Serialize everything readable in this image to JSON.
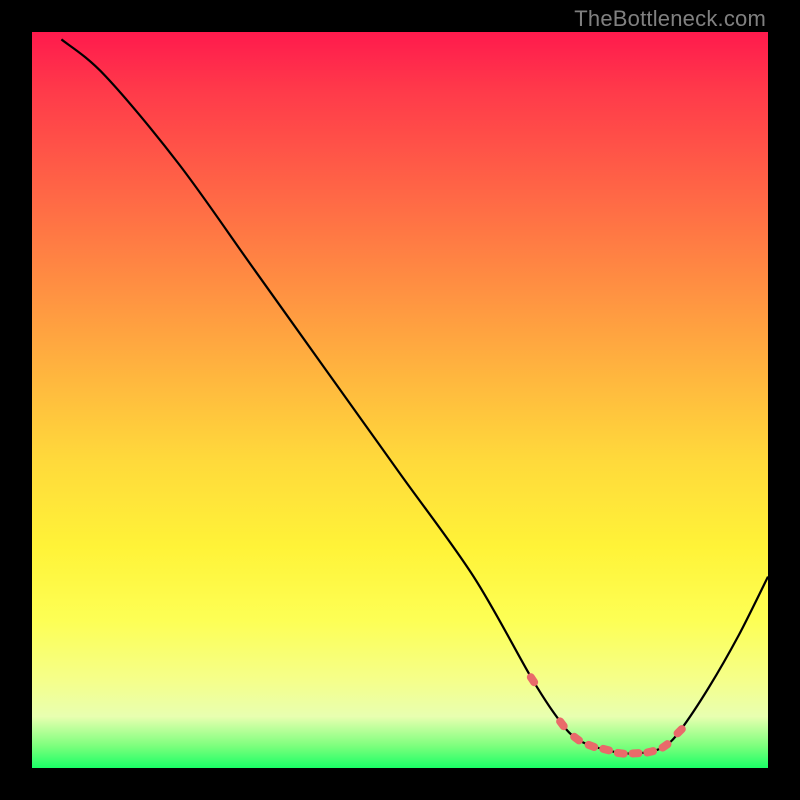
{
  "watermark": "TheBottleneck.com",
  "chart_data": {
    "type": "line",
    "title": "",
    "xlabel": "",
    "ylabel": "",
    "xlim": [
      0,
      100
    ],
    "ylim": [
      0,
      100
    ],
    "grid": false,
    "series": [
      {
        "name": "curve",
        "x": [
          4,
          10,
          20,
          30,
          40,
          50,
          60,
          68,
          72,
          74,
          76,
          78,
          80,
          82,
          84,
          86,
          88,
          92,
          96,
          100
        ],
        "y": [
          99,
          94,
          82,
          68,
          54,
          40,
          26,
          12,
          6,
          4,
          3,
          2.5,
          2,
          2,
          2.2,
          3,
          5,
          11,
          18,
          26
        ]
      }
    ],
    "markers": {
      "x": [
        68,
        72,
        74,
        76,
        78,
        80,
        82,
        84,
        86,
        88
      ],
      "y": [
        12,
        6,
        4,
        3,
        2.5,
        2,
        2,
        2.2,
        3,
        5
      ]
    },
    "background_gradient": {
      "top": "#ff1a4d",
      "mid": "#ffd93b",
      "bottom": "#1aff66"
    }
  }
}
